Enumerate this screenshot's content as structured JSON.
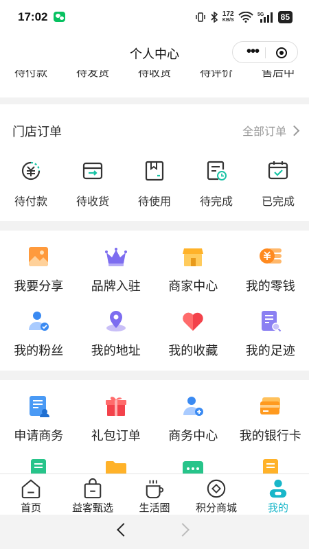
{
  "status": {
    "time": "17:02",
    "net_speed": "172",
    "net_unit": "KB/S",
    "signal": "5G",
    "battery": "85"
  },
  "nav": {
    "title": "个人中心"
  },
  "shop_orders_partial": [
    "待付款",
    "待发货",
    "待收货",
    "待评价",
    "售后中"
  ],
  "store_orders": {
    "title": "门店订单",
    "all_label": "全部订单",
    "items": [
      {
        "label": "待付款",
        "icon": "yuan-clock-icon"
      },
      {
        "label": "待收货",
        "icon": "box-arrow-icon"
      },
      {
        "label": "待使用",
        "icon": "bookmark-box-icon"
      },
      {
        "label": "待完成",
        "icon": "doc-clock-icon"
      },
      {
        "label": "已完成",
        "icon": "box-check-icon"
      }
    ]
  },
  "services_1": [
    {
      "label": "我要分享",
      "icon": "share-image-icon"
    },
    {
      "label": "品牌入驻",
      "icon": "crown-icon"
    },
    {
      "label": "商家中心",
      "icon": "shop-icon"
    },
    {
      "label": "我的零钱",
      "icon": "coins-icon"
    },
    {
      "label": "我的粉丝",
      "icon": "user-check-icon"
    },
    {
      "label": "我的地址",
      "icon": "location-icon"
    },
    {
      "label": "我的收藏",
      "icon": "heart-icon"
    },
    {
      "label": "我的足迹",
      "icon": "doc-search-icon"
    }
  ],
  "services_2": [
    {
      "label": "申请商务",
      "icon": "apply-doc-icon"
    },
    {
      "label": "礼包订单",
      "icon": "gift-icon"
    },
    {
      "label": "商务中心",
      "icon": "user-plus-icon"
    },
    {
      "label": "我的银行卡",
      "icon": "bank-card-icon"
    }
  ],
  "tabs": [
    {
      "label": "首页",
      "icon": "home-icon"
    },
    {
      "label": "益客甄选",
      "icon": "shopping-bag-icon"
    },
    {
      "label": "生活圈",
      "icon": "coffee-cup-icon"
    },
    {
      "label": "积分商城",
      "icon": "points-diamond-icon"
    },
    {
      "label": "我的",
      "icon": "profile-icon",
      "active": true
    }
  ],
  "colors": {
    "accent": "#18b6c9",
    "tab_active": "#18b6c9",
    "wechat": "#07c160"
  }
}
